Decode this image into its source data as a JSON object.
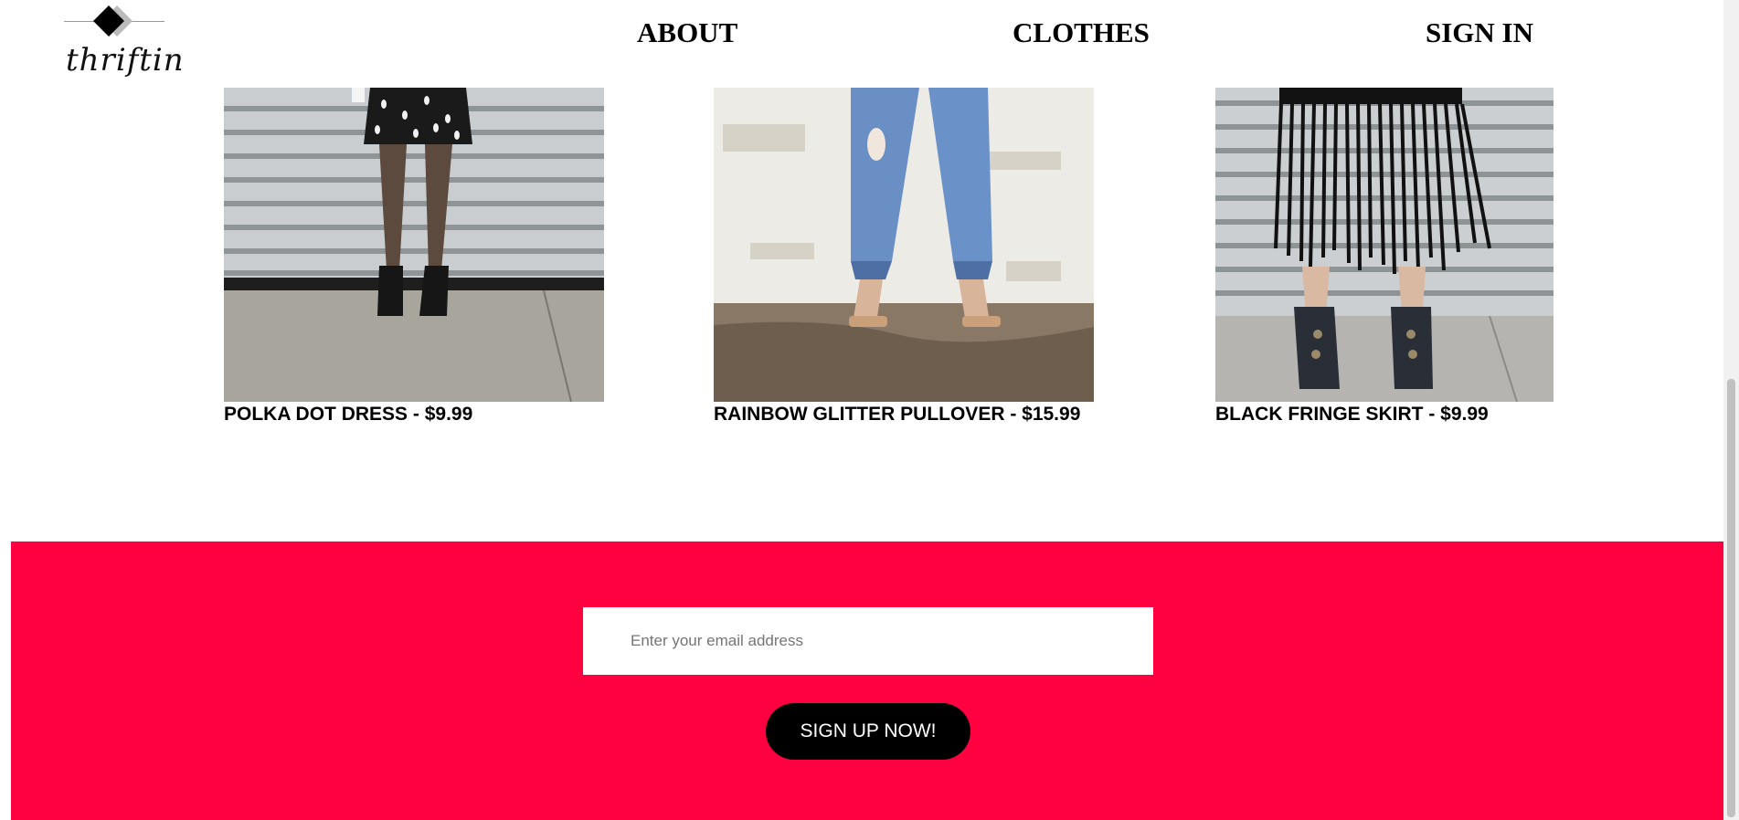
{
  "brand": {
    "name": "thriftin"
  },
  "nav": {
    "about": "ABOUT",
    "clothes": "CLOTHES",
    "sign_in": "SIGN IN"
  },
  "products": [
    {
      "caption": "POLKA DOT DRESS - $9.99"
    },
    {
      "caption": "RAINBOW GLITTER PULLOVER - $15.99"
    },
    {
      "caption": "BLACK FRINGE SKIRT - $9.99"
    }
  ],
  "signup": {
    "email_placeholder": "Enter your email address",
    "button_label": "SIGN UP NOW!"
  },
  "colors": {
    "footer_bg": "#ff0040",
    "button_bg": "#000000",
    "text": "#000000"
  }
}
